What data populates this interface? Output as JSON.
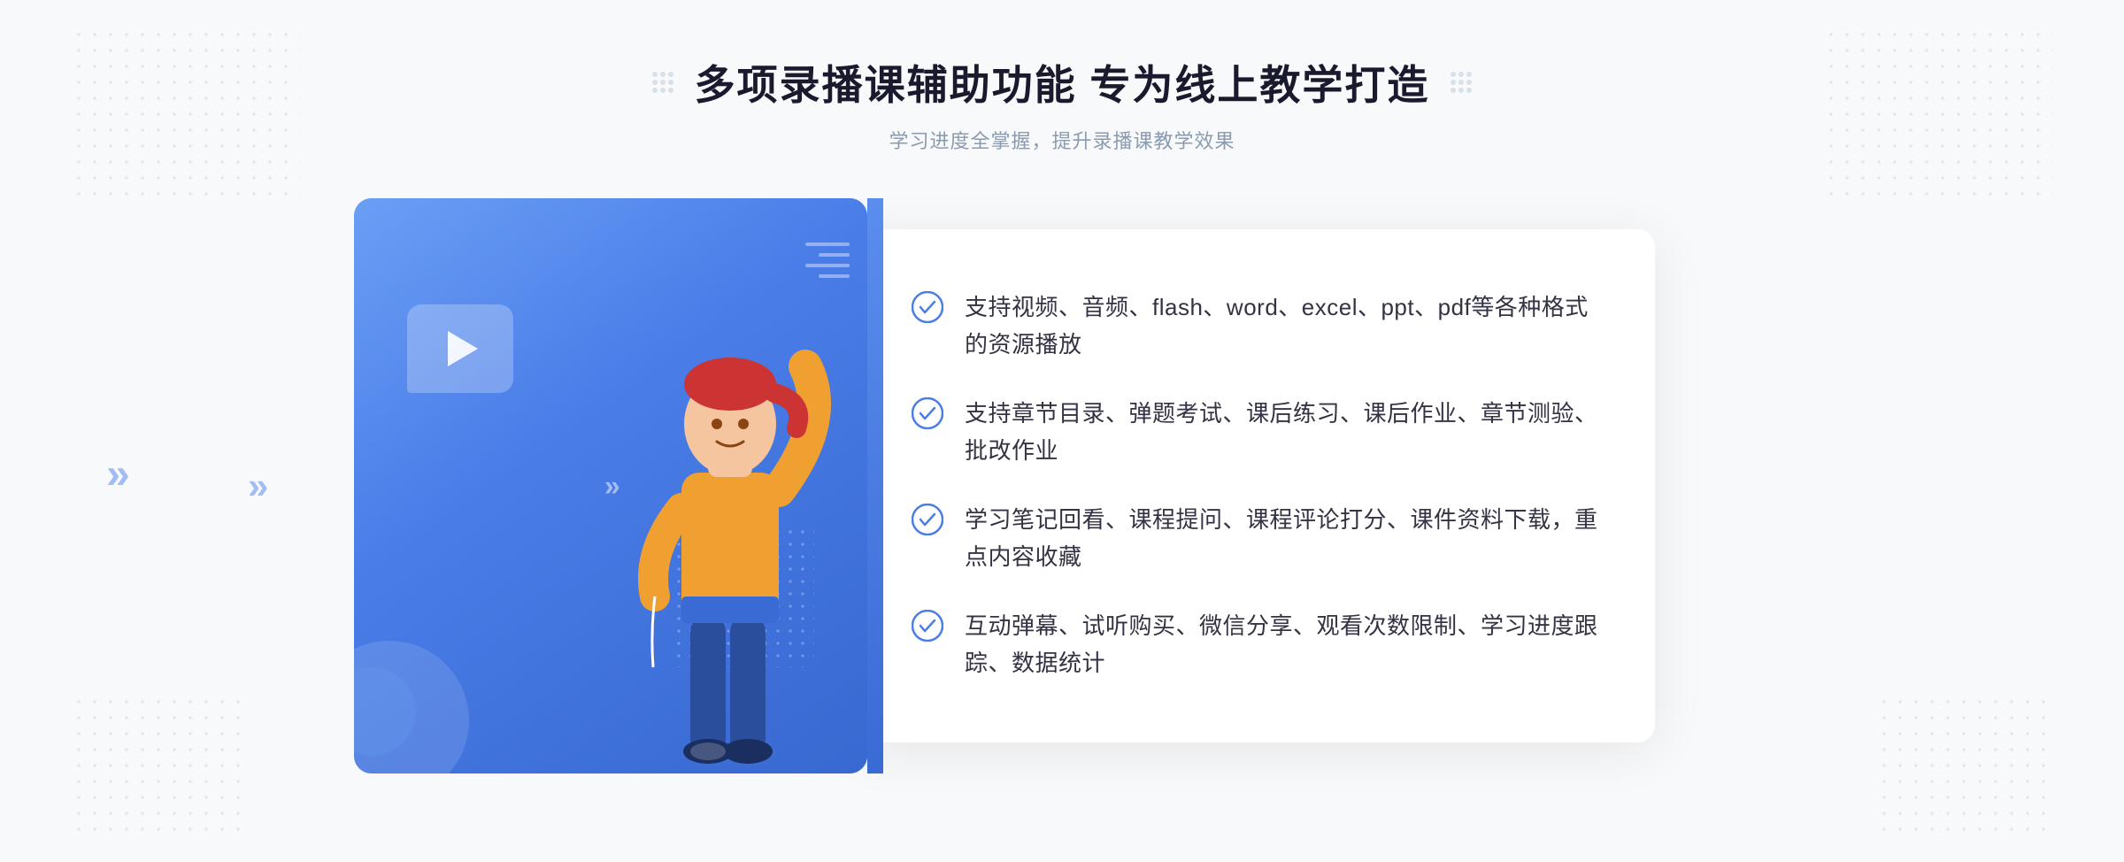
{
  "header": {
    "title": "多项录播课辅助功能 专为线上教学打造",
    "subtitle": "学习进度全掌握，提升录播课教学效果",
    "decoration_left": "❮❮",
    "decoration_right": "❯❯"
  },
  "features": [
    {
      "id": 1,
      "text": "支持视频、音频、flash、word、excel、ppt、pdf等各种格式的资源播放"
    },
    {
      "id": 2,
      "text": "支持章节目录、弹题考试、课后练习、课后作业、章节测验、批改作业"
    },
    {
      "id": 3,
      "text": "学习笔记回看、课程提问、课程评论打分、课件资料下载，重点内容收藏"
    },
    {
      "id": 4,
      "text": "互动弹幕、试听购买、微信分享、观看次数限制、学习进度跟踪、数据统计"
    }
  ],
  "colors": {
    "primary_blue": "#4a7de8",
    "light_blue": "#6b9ef5",
    "dark_blue": "#2d5bbf",
    "text_dark": "#333344",
    "text_gray": "#8a9bb0",
    "check_blue": "#4a7de8",
    "bg": "#f8f9fb"
  },
  "icons": {
    "play": "▶",
    "check": "✓",
    "chevron_left": "«"
  }
}
